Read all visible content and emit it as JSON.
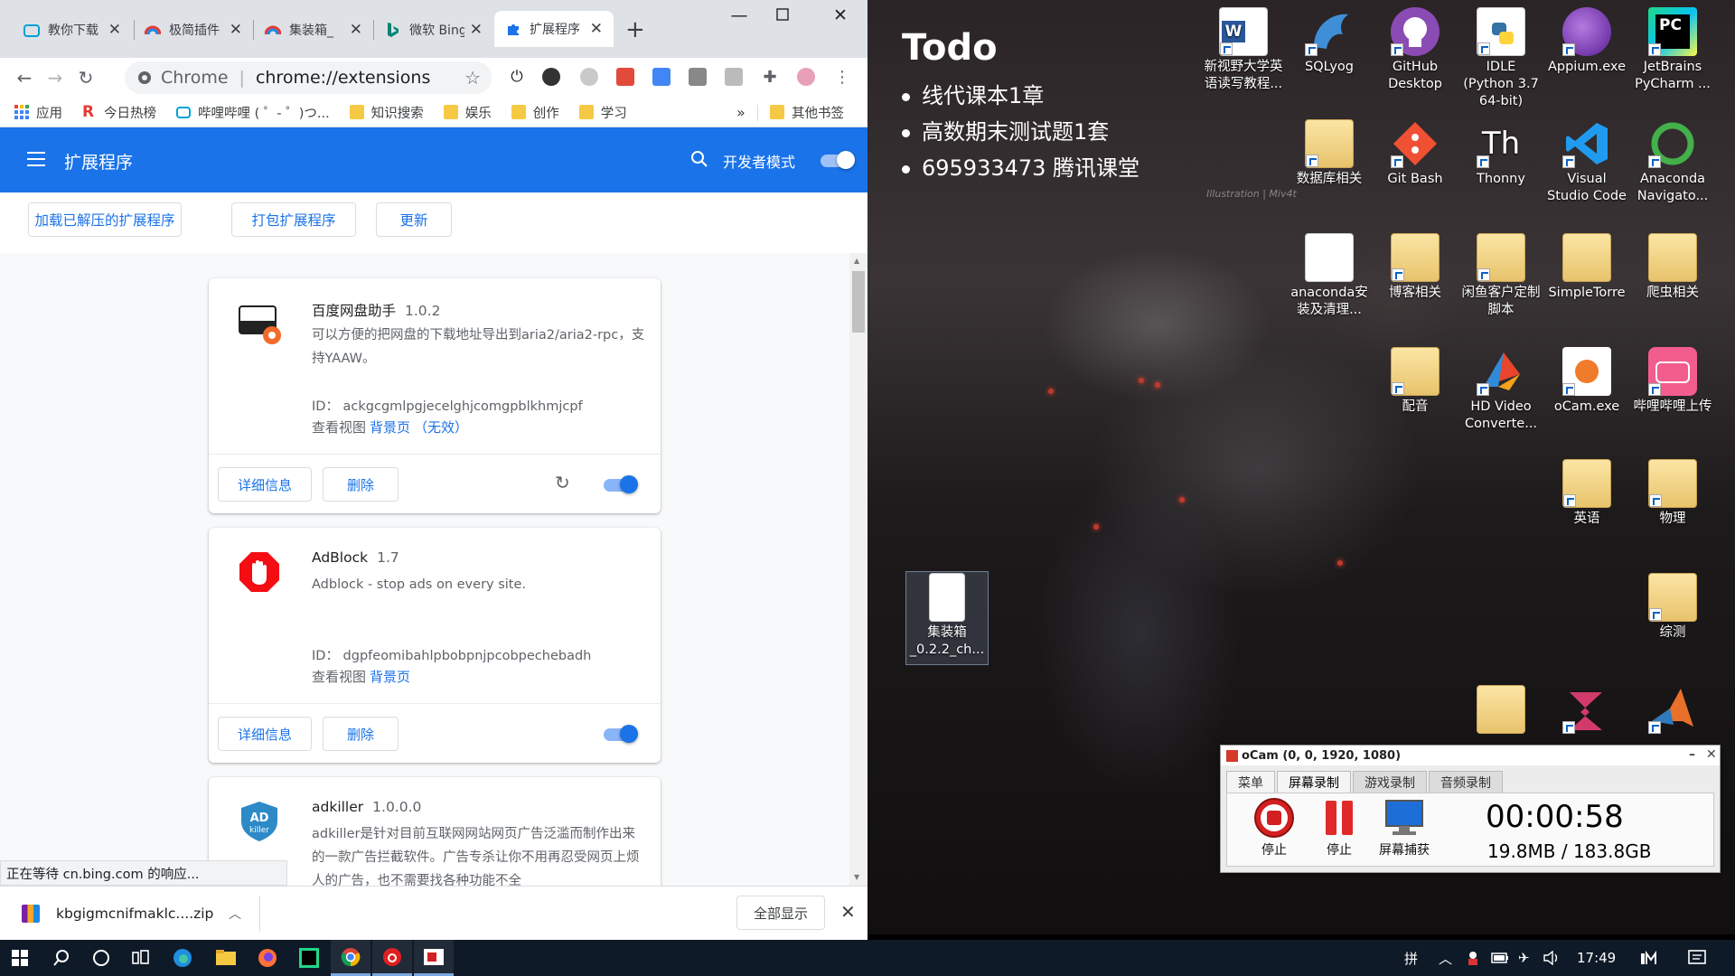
{
  "browser": {
    "tabs": [
      {
        "title": "教你下载",
        "icon": "bilibili-icon"
      },
      {
        "title": "极简插件",
        "icon": "rainbow-icon"
      },
      {
        "title": "集装箱_",
        "icon": "rainbow-icon"
      },
      {
        "title": "微软 Bing",
        "icon": "bing-icon"
      },
      {
        "title": "扩展程序",
        "icon": "puzzle-icon",
        "active": true
      }
    ],
    "omnibox": {
      "prefix": "Chrome",
      "url": "chrome://extensions"
    },
    "bookmarks": [
      "应用",
      "今日热榜",
      "哔哩哔哩 ( ゜- ゜)つ...",
      "知识搜索",
      "娱乐",
      "创作",
      "学习"
    ],
    "bookmarks_more": "»",
    "other_bookmarks": "其他书签"
  },
  "extensions_page": {
    "title": "扩展程序",
    "dev_mode_label": "开发者模式",
    "dev_mode": true,
    "actions": [
      "加载已解压的扩展程序",
      "打包扩展程序",
      "更新"
    ],
    "cards": [
      {
        "name": "百度网盘助手",
        "version": "1.0.2",
        "description": "可以方便的把网盘的下载地址导出到aria2/aria2-rpc，支持YAAW。",
        "id": "ID： ackgcgmlpgjecelghjcomgpblkhmjcpf",
        "views_label": "查看视图",
        "view_link": "背景页",
        "view_note": "（无效）",
        "details": "详细信息",
        "remove": "删除",
        "enabled": true
      },
      {
        "name": "AdBlock",
        "version": "1.7",
        "description": "Adblock - stop ads on every site.",
        "id": "ID： dgpfeomibahlpbobpnjpcobpechebadh",
        "views_label": "查看视图",
        "view_link": "背景页",
        "details": "详细信息",
        "remove": "删除",
        "enabled": true
      },
      {
        "name": "adkiller",
        "version": "1.0.0.0",
        "description": "adkiller是针对目前互联网网站网页广告泛滥而制作出来的一款广告拦截软件。广告专杀让你不用再忍受网页上烦人的广告，也不需要找各种功能不全"
      }
    ],
    "status_tip": "正在等待 cn.bing.com 的响应..."
  },
  "download_bar": {
    "file": "kbgigmcnifmaklc....zip",
    "show_all": "全部显示"
  },
  "todo": {
    "title": "Todo",
    "items": [
      "线代课本1章",
      "高数期末测试题1套",
      "695933473 腾讯课堂"
    ]
  },
  "wallpaper_signature": "Illustration | Miv4t",
  "desktop_icons": [
    {
      "label": "新视野大学英语读写教程...",
      "icon": "word-icon"
    },
    {
      "label": "SQLyog",
      "icon": "dolphin-icon"
    },
    {
      "label": "GitHub Desktop",
      "icon": "github-icon"
    },
    {
      "label": "IDLE (Python 3.7 64-bit)",
      "icon": "python-icon"
    },
    {
      "label": "Appium.exe",
      "icon": "appium-icon"
    },
    {
      "label": "JetBrains PyCharm ...",
      "icon": "pycharm-icon"
    },
    {
      "label": "数据库相关",
      "icon": "folder-icon"
    },
    {
      "label": "Git Bash",
      "icon": "git-icon"
    },
    {
      "label": "Thonny",
      "icon": "thonny-icon"
    },
    {
      "label": "Visual Studio Code",
      "icon": "vscode-icon"
    },
    {
      "label": "Anaconda Navigato...",
      "icon": "anaconda-icon"
    },
    {
      "label": "anaconda安装及清理...",
      "icon": "document-icon"
    },
    {
      "label": "博客相关",
      "icon": "folder-icon"
    },
    {
      "label": "闲鱼客户定制脚本",
      "icon": "folder-icon"
    },
    {
      "label": "SimpleTorre",
      "icon": "folder-icon"
    },
    {
      "label": "爬虫相关",
      "icon": "folder-icon"
    },
    {
      "label": "配音",
      "icon": "folder-icon"
    },
    {
      "label": "HD Video Converte...",
      "icon": "hdvideo-icon"
    },
    {
      "label": "oCam.exe",
      "icon": "ocam-icon"
    },
    {
      "label": "哔哩哔哩上传",
      "icon": "bilibili-icon"
    },
    {
      "label": "英语",
      "icon": "folder-icon"
    },
    {
      "label": "物理",
      "icon": "folder-icon"
    },
    {
      "label": "综测",
      "icon": "folder-icon"
    },
    {
      "label": "集装箱_0.2.2_ch...",
      "icon": "document-icon"
    }
  ],
  "ocam": {
    "title": "oCam (0, 0, 1920, 1080)",
    "tabs": [
      "菜单",
      "屏幕录制",
      "游戏录制",
      "音频录制"
    ],
    "buttons": [
      "停止",
      "停止",
      "屏幕捕获"
    ],
    "timer": "00:00:58",
    "size": "19.8MB / 183.8GB"
  },
  "taskbar": {
    "time": "17:49",
    "ime": "拼"
  }
}
